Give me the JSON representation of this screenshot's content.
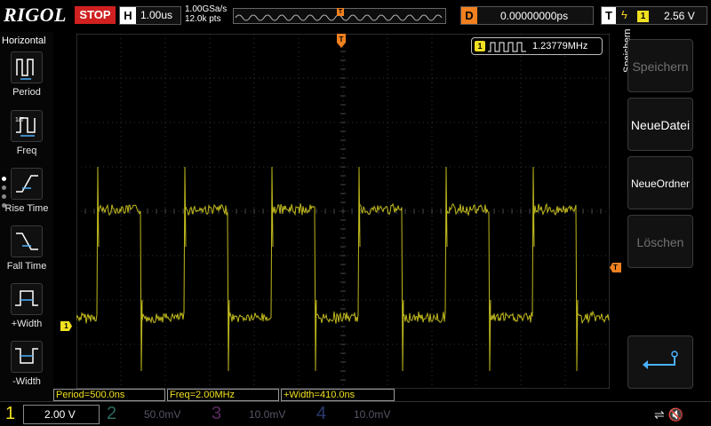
{
  "header": {
    "brand": "RIGOL",
    "run_state": "STOP",
    "horizontal": {
      "tag": "H",
      "timebase": "1.00us"
    },
    "acquisition": {
      "sample_rate": "1.00GSa/s",
      "memory_depth": "12.0k pts"
    },
    "delay": {
      "tag": "D",
      "value": "0.00000000ps"
    },
    "trigger": {
      "tag": "T",
      "edge_symbol": "ϟ",
      "source": "1",
      "level": "2.56 V"
    }
  },
  "left_menu": {
    "title": "Horizontal",
    "items": [
      {
        "label": "Period",
        "icon": "period-icon"
      },
      {
        "label": "Freq",
        "icon": "freq-icon"
      },
      {
        "label": "Rise Time",
        "icon": "rise-time-icon"
      },
      {
        "label": "Fall Time",
        "icon": "fall-time-icon"
      },
      {
        "label": "+Width",
        "icon": "pos-width-icon"
      },
      {
        "label": "-Width",
        "icon": "neg-width-icon"
      }
    ]
  },
  "counter": {
    "channel": "1",
    "frequency": "1.23779MHz"
  },
  "markers": {
    "trigger_position": "T",
    "channel1": "1",
    "trigger_level": "T"
  },
  "measurements": [
    {
      "text": "Period=500.0ns"
    },
    {
      "text": "Freq=2.00MHz"
    },
    {
      "text": "+Width=410.0ns"
    }
  ],
  "right_menu": {
    "title": "Speichern",
    "buttons": [
      {
        "label": "Speichern",
        "enabled": false
      },
      {
        "label": "NeueDatei",
        "enabled": true
      },
      {
        "label": "NeueOrdner",
        "enabled": true
      },
      {
        "label": "Löschen",
        "enabled": false
      },
      {
        "label": "",
        "icon": "return-icon",
        "enabled": true
      }
    ]
  },
  "channels": [
    {
      "number": "1",
      "scale": "2.00 V",
      "active": true,
      "color": "#f0e020"
    },
    {
      "number": "2",
      "scale": "50.0mV",
      "active": false,
      "color": "#20c0a0"
    },
    {
      "number": "3",
      "scale": "10.0mV",
      "active": false,
      "color": "#c040c0"
    },
    {
      "number": "4",
      "scale": "10.0mV",
      "active": false,
      "color": "#4060e0"
    }
  ],
  "status_icons": [
    "usb-icon",
    "mute-speaker-icon"
  ],
  "colors": {
    "trace": "#d4cc20",
    "grid": "#3a3a3a",
    "trigger": "#f08020",
    "stop": "#d02020"
  }
}
